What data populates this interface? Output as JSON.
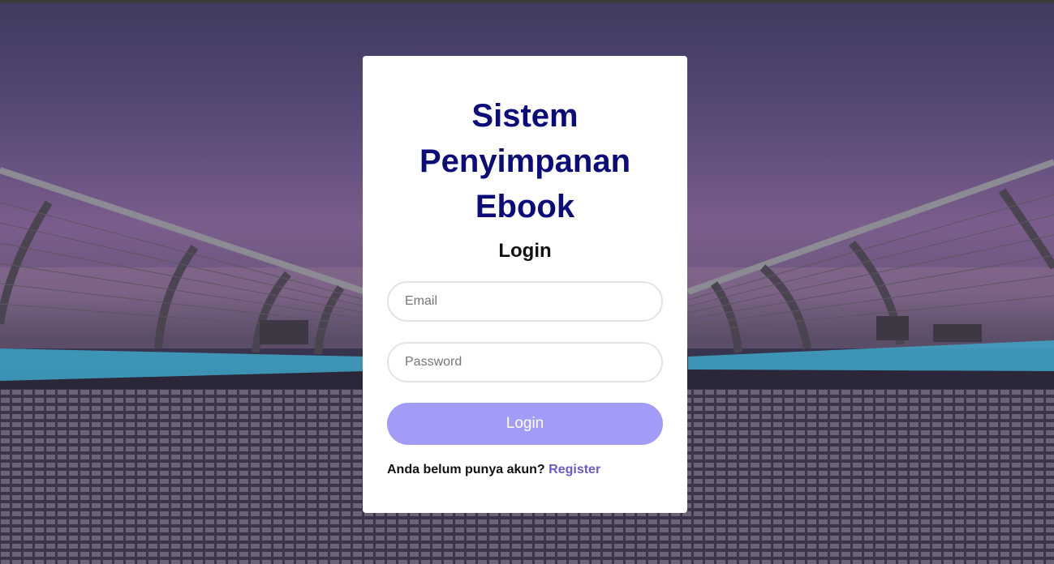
{
  "card": {
    "title": "Sistem Penyimpanan Ebook",
    "subtitle": "Login",
    "email_placeholder": "Email",
    "email_value": "",
    "password_placeholder": "Password",
    "password_value": "",
    "login_button": "Login",
    "register_prompt": "Anda belum punya akun?",
    "register_link": "Register"
  },
  "colors": {
    "title": "#0b0b7a",
    "button": "#a29bf7",
    "link": "#6a5acd"
  },
  "icons": {
    "background": "bridge-photo"
  }
}
